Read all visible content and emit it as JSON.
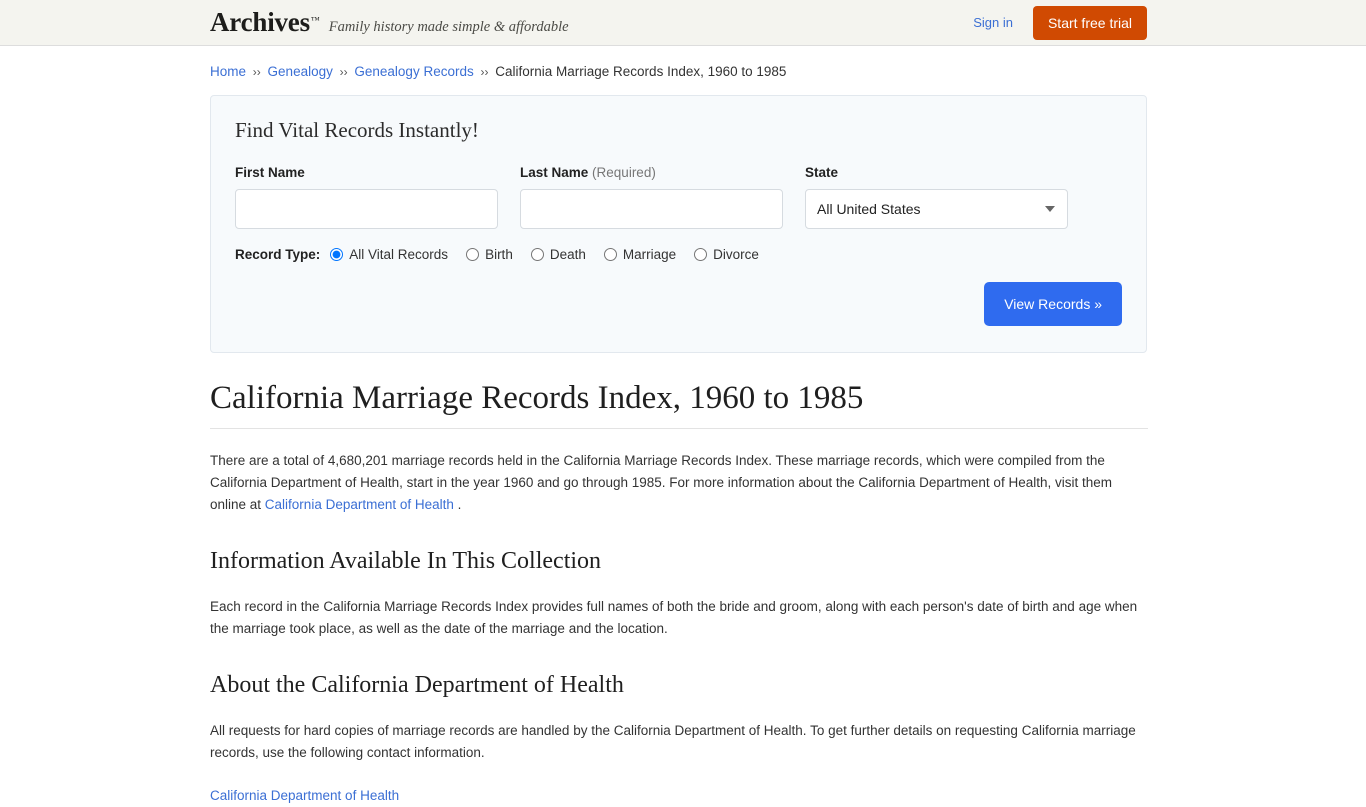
{
  "header": {
    "brand_name": "Archives",
    "brand_tm": "™",
    "tagline": "Family history made simple & affordable",
    "sign_in": "Sign in",
    "start_trial": "Start free trial",
    "trial_color": "#d04a02",
    "link_color": "#3b6fd4"
  },
  "breadcrumb": {
    "separator": "››",
    "items": [
      {
        "label": "Home",
        "link": true
      },
      {
        "label": "Genealogy",
        "link": true
      },
      {
        "label": "Genealogy Records",
        "link": true
      },
      {
        "label": "California Marriage Records Index, 1960 to 1985",
        "link": false
      }
    ]
  },
  "search_panel": {
    "title": "Find Vital Records Instantly!",
    "first_name": {
      "label": "First Name",
      "value": "",
      "placeholder": ""
    },
    "last_name": {
      "label": "Last Name",
      "required_note": "(Required)",
      "value": "",
      "placeholder": ""
    },
    "state": {
      "label": "State",
      "selected": "All United States"
    },
    "record_type": {
      "label": "Record Type:",
      "options": [
        {
          "label": "All Vital Records",
          "selected": true
        },
        {
          "label": "Birth",
          "selected": false
        },
        {
          "label": "Death",
          "selected": false
        },
        {
          "label": "Marriage",
          "selected": false
        },
        {
          "label": "Divorce",
          "selected": false
        }
      ]
    },
    "submit_label": "View Records »",
    "submit_color": "#2f6bef"
  },
  "article": {
    "title": "California Marriage Records Index, 1960 to 1985",
    "intro_part1": "There are a total of 4,680,201 marriage records held in the California Marriage Records Index. These marriage records, which were compiled from the California Department of Health, start in the year 1960 and go through 1985. For more information about the California Department of Health, visit them online at ",
    "intro_link": "California Department of Health",
    "intro_part2": " .",
    "section1_heading": "Information Available In This Collection",
    "section1_text": "Each record in the California Marriage Records Index provides full names of both the bride and groom, along with each person's date of birth and age when the marriage took place, as well as the date of the marriage and the location.",
    "section2_heading": "About the California Department of Health",
    "section2_text": "All requests for hard copies of marriage records are handled by the California Department of Health. To get further details on requesting California marriage records, use the following contact information.",
    "contact_link": "California Department of Health"
  }
}
